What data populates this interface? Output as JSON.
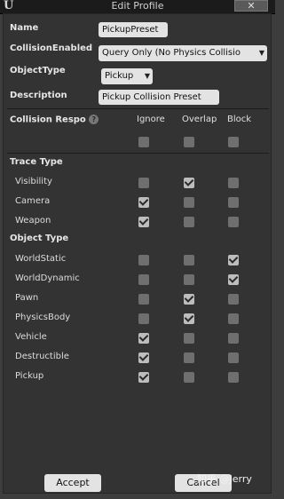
{
  "window": {
    "title": "Edit Profile",
    "close_label": "✕",
    "logo_letter": "U"
  },
  "fields": {
    "name_label": "Name",
    "name_value": "PickupPreset",
    "collision_enabled_label": "CollisionEnabled",
    "collision_enabled_value": "Query Only (No Physics Collisio",
    "object_type_label": "ObjectType",
    "object_type_value": "Pickup",
    "description_label": "Description",
    "description_value": "Pickup Collision Preset"
  },
  "responses": {
    "header_label": "Collision Respo",
    "help_glyph": "?",
    "columns": [
      "Ignore",
      "Overlap",
      "Block"
    ],
    "all_row": {
      "checked": [
        false,
        false,
        false
      ]
    },
    "trace_section": "Trace Type",
    "trace_rows": [
      {
        "name": "Visibility",
        "checked": [
          false,
          true,
          false
        ]
      },
      {
        "name": "Camera",
        "checked": [
          true,
          false,
          false
        ]
      },
      {
        "name": "Weapon",
        "checked": [
          true,
          false,
          false
        ]
      }
    ],
    "object_section": "Object Type",
    "object_rows": [
      {
        "name": "WorldStatic",
        "checked": [
          false,
          false,
          true
        ]
      },
      {
        "name": "WorldDynamic",
        "checked": [
          false,
          false,
          true
        ]
      },
      {
        "name": "Pawn",
        "checked": [
          false,
          true,
          false
        ]
      },
      {
        "name": "PhysicsBody",
        "checked": [
          false,
          true,
          false
        ]
      },
      {
        "name": "Vehicle",
        "checked": [
          true,
          false,
          false
        ]
      },
      {
        "name": "Destructible",
        "checked": [
          true,
          false,
          false
        ]
      },
      {
        "name": "Pickup",
        "checked": [
          true,
          false,
          false
        ]
      }
    ]
  },
  "buttons": {
    "accept": "Accept",
    "cancel": "Cancel"
  },
  "watermark": "知乎 @Jerry"
}
